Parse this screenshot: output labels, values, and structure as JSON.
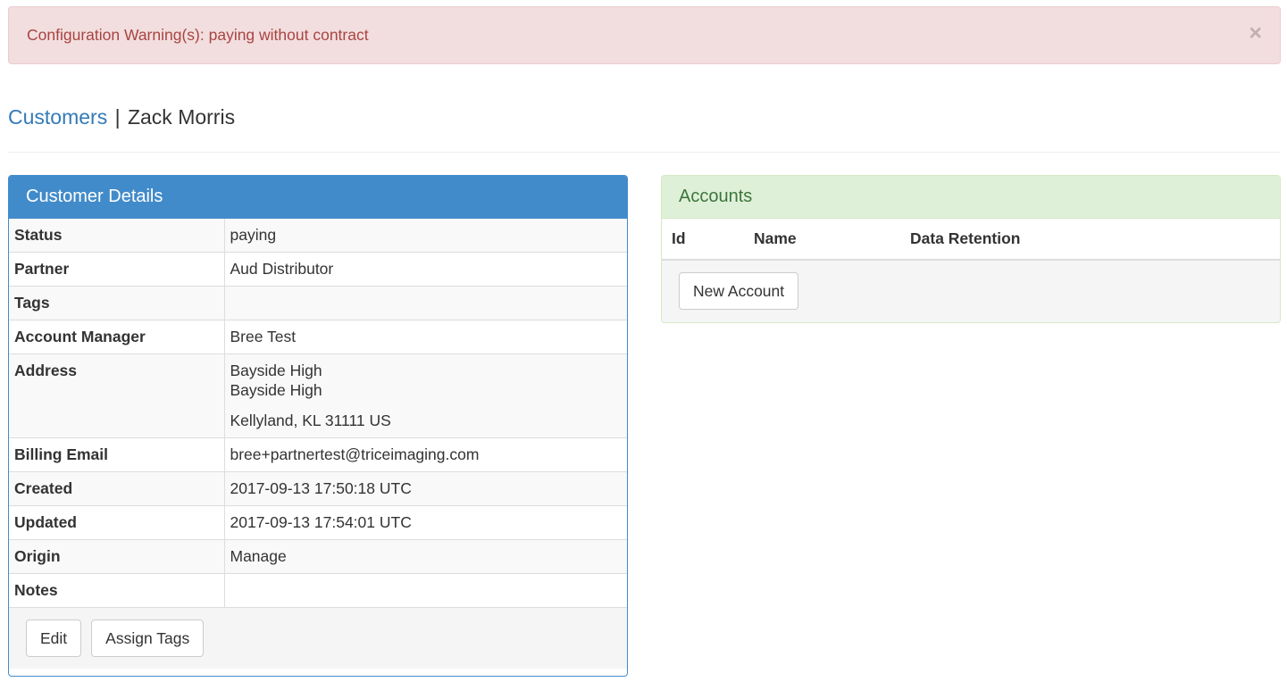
{
  "alert": {
    "message": "Configuration Warning(s): paying without contract",
    "close_glyph": "×"
  },
  "header": {
    "breadcrumb_link": "Customers",
    "separator": "|",
    "customer_name": "Zack Morris"
  },
  "customer_details": {
    "title": "Customer Details",
    "rows": [
      {
        "key": "Status",
        "value": "paying"
      },
      {
        "key": "Partner",
        "value": "Aud Distributor"
      },
      {
        "key": "Tags",
        "value": ""
      },
      {
        "key": "Account Manager",
        "value": "Bree Test"
      },
      {
        "key": "Address",
        "lines": [
          "Bayside High",
          "Bayside High",
          "Kellyland, KL 31111 US"
        ]
      },
      {
        "key": "Billing Email",
        "value": "bree+partnertest@triceimaging.com"
      },
      {
        "key": "Created",
        "value": "2017-09-13 17:50:18 UTC"
      },
      {
        "key": "Updated",
        "value": "2017-09-13 17:54:01 UTC"
      },
      {
        "key": "Origin",
        "value": "Manage"
      },
      {
        "key": "Notes",
        "value": ""
      }
    ],
    "edit_label": "Edit",
    "assign_tags_label": "Assign Tags"
  },
  "accounts": {
    "title": "Accounts",
    "columns": [
      "Id",
      "Name",
      "Data Retention"
    ],
    "new_account_label": "New Account"
  },
  "colors": {
    "primary": "#428bca",
    "alert_bg": "#f2dede",
    "alert_text": "#a94442",
    "success_bg": "#dff0d8",
    "success_text": "#3c763d",
    "link": "#337ab7"
  }
}
